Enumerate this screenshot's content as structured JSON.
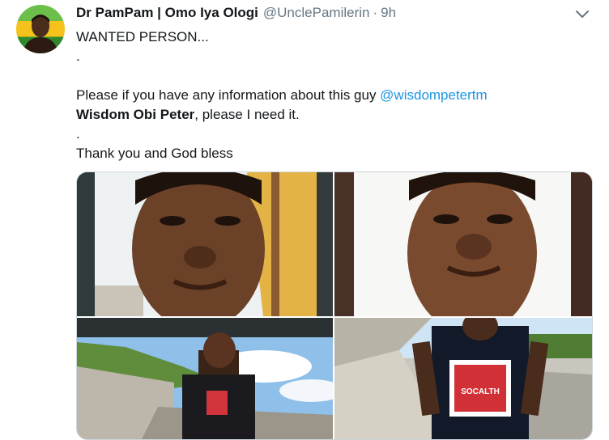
{
  "tweet": {
    "display_name": "Dr PamPam | Omo Iya Ologi",
    "handle": "@UnclePamilerin",
    "separator": "·",
    "time": "9h",
    "caret_icon": "chevron-down-icon",
    "lines": {
      "line1": "WANTED PERSON...",
      "line2": ".",
      "line3_prefix": "Please if you have any information about this guy ",
      "mention": "@wisdompetertm",
      "line4_bold": "Wisdom Obi Peter",
      "line4_rest": ", please I need it.",
      "line5": ".",
      "line6": "Thank you and God bless"
    },
    "shirt_text": "SOCALTH",
    "photos": [
      "selfie-closeup-1",
      "selfie-closeup-2",
      "outdoor-photo-1",
      "outdoor-photo-2"
    ]
  },
  "colors": {
    "text": "#14171a",
    "secondary": "#657786",
    "link": "#1b95e0",
    "border": "#ccd6dd"
  }
}
